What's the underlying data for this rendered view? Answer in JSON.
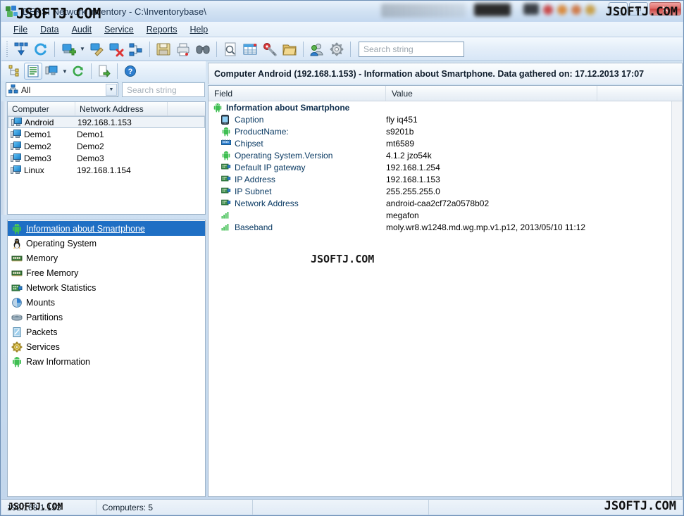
{
  "window": {
    "title": "DEKSI Network Inventory - C:\\Inventorybase\\",
    "icon": "network-app-icon",
    "controls": {
      "minimize": "–",
      "maximize": "□",
      "close": "✕"
    }
  },
  "watermarks": {
    "title": "JSOFTJ.COM",
    "top_right": "JSOFTJ.COM",
    "center": "JSOFTJ.COM",
    "status_left": "JSOFTJ.COM",
    "status_right": "JSOFTJ.COM"
  },
  "menubar": {
    "items": [
      {
        "label": "File",
        "accel": "F"
      },
      {
        "label": "Data",
        "accel": "D"
      },
      {
        "label": "Audit",
        "accel": "A"
      },
      {
        "label": "Service",
        "accel": "S"
      },
      {
        "label": "Reports",
        "accel": "R"
      },
      {
        "label": "Help",
        "accel": "H"
      }
    ]
  },
  "toolbar": {
    "buttons": [
      {
        "name": "scan-network-icon"
      },
      {
        "name": "refresh-icon"
      },
      {
        "name": "add-computer-icon",
        "has_dropdown": true
      },
      {
        "name": "edit-computer-icon"
      },
      {
        "name": "delete-computer-icon"
      },
      {
        "name": "group-icon"
      },
      {
        "name": "save-icon"
      },
      {
        "name": "print-icon"
      },
      {
        "name": "find-icon"
      },
      {
        "name": "preview-icon"
      },
      {
        "name": "report-table-icon"
      },
      {
        "name": "license-key-icon"
      },
      {
        "name": "folder-icon"
      },
      {
        "name": "users-icon"
      },
      {
        "name": "settings-gear-icon"
      }
    ],
    "search": {
      "placeholder": "Search string",
      "value": ""
    }
  },
  "sidebar_toolbar": {
    "buttons": [
      {
        "name": "tree-view-icon"
      },
      {
        "name": "list-view-icon",
        "active": true
      },
      {
        "name": "computer-view-icon",
        "has_dropdown": true
      },
      {
        "name": "refresh-list-icon"
      },
      {
        "name": "export-icon"
      },
      {
        "name": "help-icon"
      }
    ],
    "filter": {
      "label": "All",
      "icon": "network-group-icon"
    },
    "search": {
      "placeholder": "Search string",
      "value": ""
    }
  },
  "computer_list": {
    "columns": [
      "Computer",
      "Network Address"
    ],
    "rows": [
      {
        "computer": "Android",
        "address": "192.168.1.153",
        "selected": true
      },
      {
        "computer": "Demo1",
        "address": "Demo1",
        "selected": false
      },
      {
        "computer": "Demo2",
        "address": "Demo2",
        "selected": false
      },
      {
        "computer": "Demo3",
        "address": "Demo3",
        "selected": false
      },
      {
        "computer": "Linux",
        "address": "192.168.1.154",
        "selected": false
      }
    ]
  },
  "category_list": {
    "items": [
      {
        "label": "Information about Smartphone",
        "icon": "android-icon",
        "selected": true
      },
      {
        "label": "Operating System",
        "icon": "penguin-icon",
        "selected": false
      },
      {
        "label": "Memory",
        "icon": "memory-module-icon",
        "selected": false
      },
      {
        "label": "Free Memory",
        "icon": "memory-module-icon",
        "selected": false
      },
      {
        "label": "Network Statistics",
        "icon": "network-card-icon",
        "selected": false
      },
      {
        "label": "Mounts",
        "icon": "pie-disk-icon",
        "selected": false
      },
      {
        "label": "Partitions",
        "icon": "hard-disk-icon",
        "selected": false
      },
      {
        "label": "Packets",
        "icon": "package-icon",
        "selected": false
      },
      {
        "label": "Services",
        "icon": "gear-icon",
        "selected": false
      },
      {
        "label": "Raw Information",
        "icon": "android-icon",
        "selected": false
      }
    ]
  },
  "detail": {
    "header": "Computer Android (192.168.1.153) - Information about Smartphone. Data gathered on: 17.12.2013 17:07",
    "columns": [
      "Field",
      "Value",
      ""
    ],
    "group": {
      "label": "Information about Smartphone",
      "icon": "android-icon"
    },
    "rows": [
      {
        "field": "Caption",
        "value": "fly iq451",
        "icon": "smartphone-icon"
      },
      {
        "field": "ProductName:",
        "value": "s9201b",
        "icon": "android-icon"
      },
      {
        "field": "Chipset",
        "value": "mt6589",
        "icon": "chip-icon"
      },
      {
        "field": "Operating System.Version",
        "value": "4.1.2 jzo54k",
        "icon": "android-icon"
      },
      {
        "field": "Default IP gateway",
        "value": "192.168.1.254",
        "icon": "network-card-icon"
      },
      {
        "field": "IP Address",
        "value": "192.168.1.153",
        "icon": "network-card-icon"
      },
      {
        "field": "IP Subnet",
        "value": "255.255.255.0",
        "icon": "network-card-icon"
      },
      {
        "field": "Network Address",
        "value": "android-caa2cf72a0578b02",
        "icon": "network-card-icon"
      },
      {
        "field": "",
        "value": "megafon",
        "icon": "signal-bars-icon"
      },
      {
        "field": "Baseband",
        "value": "moly.wr8.w1248.md.wg.mp.v1.p12, 2013/05/10 11:12",
        "icon": "signal-bars-icon"
      }
    ]
  },
  "statusbar": {
    "cells": [
      {
        "text": "192.168.1.153"
      },
      {
        "text": "Computers: 5"
      },
      {
        "text": ""
      },
      {
        "text": ""
      }
    ]
  },
  "colors": {
    "selection": "#1f6fc4",
    "accent": "#2f7fd0",
    "close_button": "#cf4a48",
    "field_text": "#0a3a63"
  }
}
